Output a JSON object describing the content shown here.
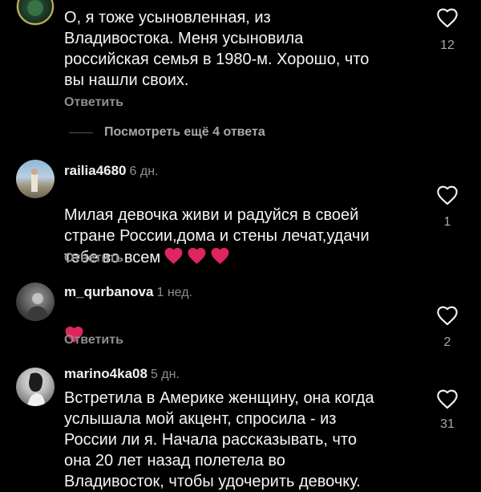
{
  "comments": [
    {
      "author": "",
      "age": "",
      "text": "О, я тоже усыновленная, из\nВладивостока. Меня усыновила\nроссийская семья в 1980-м. Хорошо, что\nвы нашли своих.",
      "reply_label": "Ответить",
      "likes": "12",
      "view_more": "Посмотреть ещё 4 ответа"
    },
    {
      "author": "railia4680",
      "age": "6 дн.",
      "text": "Милая девочка живи и радуйся в своей\nстране России,дома и  стены лечат,удачи\nтебе во всем",
      "hearts": 3,
      "reply_label": "Ответить",
      "likes": "1"
    },
    {
      "author": "m_qurbanova",
      "age": "1 нед.",
      "text": "",
      "hearts": 1,
      "reply_label": "Ответить",
      "likes": "2"
    },
    {
      "author": "marino4ka08",
      "age": "5 дн.",
      "text": "Встретила в Америке женщину, она когда\nуслышала мой акцент, спросила - из\nРоссии ли я. Начала рассказывать, что\nона 20 лет назад полетела во\nВладивосток, чтобы удочерить девочку.",
      "reply_label": "",
      "likes": "31"
    }
  ],
  "colors": {
    "background": "#000000",
    "text": "#f5f5f5",
    "muted": "#8e8e8e",
    "heart_emoji": "#e0245e"
  },
  "icons": {
    "like": "heart-outline-icon",
    "emoji": "red-heart-emoji"
  }
}
